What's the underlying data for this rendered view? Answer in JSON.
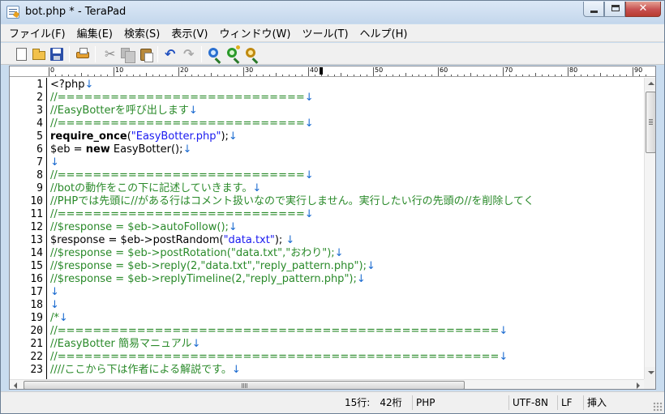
{
  "window": {
    "title": "bot.php * - TeraPad"
  },
  "menu": [
    {
      "id": "file",
      "label": "ファイル(F)"
    },
    {
      "id": "edit",
      "label": "編集(E)"
    },
    {
      "id": "search",
      "label": "検索(S)"
    },
    {
      "id": "view",
      "label": "表示(V)"
    },
    {
      "id": "window",
      "label": "ウィンドウ(W)"
    },
    {
      "id": "tools",
      "label": "ツール(T)"
    },
    {
      "id": "help",
      "label": "ヘルプ(H)"
    }
  ],
  "toolbar_icons": [
    "new-file-icon",
    "open-folder-icon",
    "save-icon",
    "print-icon",
    "cut-icon",
    "copy-icon",
    "paste-icon",
    "undo-icon",
    "redo-icon",
    "find-icon",
    "find-next-icon",
    "find-prev-icon"
  ],
  "ruler": {
    "labels": [
      "0",
      "10",
      "20",
      "30",
      "40",
      "50",
      "60",
      "70",
      "80",
      "90"
    ],
    "cursor_column": 42
  },
  "editor": {
    "eol_mark": "↓",
    "lines": [
      {
        "no": "1",
        "segments": [
          {
            "t": "<?php",
            "c": "plain"
          }
        ],
        "eol": true
      },
      {
        "no": "2",
        "segments": [
          {
            "t": "//============================",
            "c": "comment"
          }
        ],
        "eol": true
      },
      {
        "no": "3",
        "segments": [
          {
            "t": "//EasyBotterを呼び出します",
            "c": "comment"
          }
        ],
        "eol": true
      },
      {
        "no": "4",
        "segments": [
          {
            "t": "//============================",
            "c": "comment"
          }
        ],
        "eol": true
      },
      {
        "no": "5",
        "segments": [
          {
            "t": "require_once",
            "c": "kw"
          },
          {
            "t": "(",
            "c": "plain"
          },
          {
            "t": "\"EasyBotter.php\"",
            "c": "string"
          },
          {
            "t": ");",
            "c": "plain"
          }
        ],
        "eol": true
      },
      {
        "no": "6",
        "segments": [
          {
            "t": "$eb = ",
            "c": "plain"
          },
          {
            "t": "new",
            "c": "kw"
          },
          {
            "t": " EasyBotter();",
            "c": "plain"
          }
        ],
        "eol": true
      },
      {
        "no": "7",
        "segments": [],
        "eol": true
      },
      {
        "no": "8",
        "segments": [
          {
            "t": "//============================",
            "c": "comment"
          }
        ],
        "eol": true
      },
      {
        "no": "9",
        "segments": [
          {
            "t": "//botの動作をこの下に記述していきます。",
            "c": "comment"
          }
        ],
        "eol": true
      },
      {
        "no": "10",
        "segments": [
          {
            "t": "//PHPでは先頭に//がある行はコメント扱いなので実行しません。実行したい行の先頭の//を削除してく",
            "c": "comment"
          }
        ],
        "eol": false
      },
      {
        "no": "11",
        "segments": [
          {
            "t": "//============================",
            "c": "comment"
          }
        ],
        "eol": true
      },
      {
        "no": "12",
        "segments": [
          {
            "t": "//$response = $eb->autoFollow();",
            "c": "comment"
          }
        ],
        "eol": true
      },
      {
        "no": "13",
        "segments": [
          {
            "t": "$response = $eb->postRandom(",
            "c": "plain"
          },
          {
            "t": "\"data.txt\"",
            "c": "string"
          },
          {
            "t": "); ",
            "c": "plain"
          }
        ],
        "eol": true
      },
      {
        "no": "14",
        "segments": [
          {
            "t": "//$response = $eb->postRotation(\"data.txt\",\"おわり\");",
            "c": "comment"
          }
        ],
        "eol": true
      },
      {
        "no": "15",
        "segments": [
          {
            "t": "//$response = $eb->reply(2,\"data.txt\",\"reply_pattern.php\");",
            "c": "comment"
          }
        ],
        "eol": true
      },
      {
        "no": "16",
        "segments": [
          {
            "t": "//$response = $eb->replyTimeline(2,\"reply_pattern.php\");",
            "c": "comment"
          }
        ],
        "eol": true
      },
      {
        "no": "17",
        "segments": [],
        "eol": true
      },
      {
        "no": "18",
        "segments": [],
        "eol": true
      },
      {
        "no": "19",
        "segments": [
          {
            "t": "/*",
            "c": "comment"
          }
        ],
        "eol": true
      },
      {
        "no": "20",
        "segments": [
          {
            "t": "//==================================================",
            "c": "comment"
          }
        ],
        "eol": true
      },
      {
        "no": "21",
        "segments": [
          {
            "t": "//EasyBotter 簡易マニュアル",
            "c": "comment"
          }
        ],
        "eol": true
      },
      {
        "no": "22",
        "segments": [
          {
            "t": "//==================================================",
            "c": "comment"
          }
        ],
        "eol": true
      },
      {
        "no": "23",
        "segments": [
          {
            "t": "////ここから下は作者による解説です。",
            "c": "comment"
          }
        ],
        "eol": true
      }
    ]
  },
  "status": {
    "position": "15行:　42桁",
    "syntax": "PHP",
    "encoding": "UTF-8N",
    "line_ending": "LF",
    "mode": "挿入"
  },
  "colors": {
    "comment": "#2a8a2a",
    "string": "#1a1af0",
    "eol": "#1a6ad0"
  }
}
